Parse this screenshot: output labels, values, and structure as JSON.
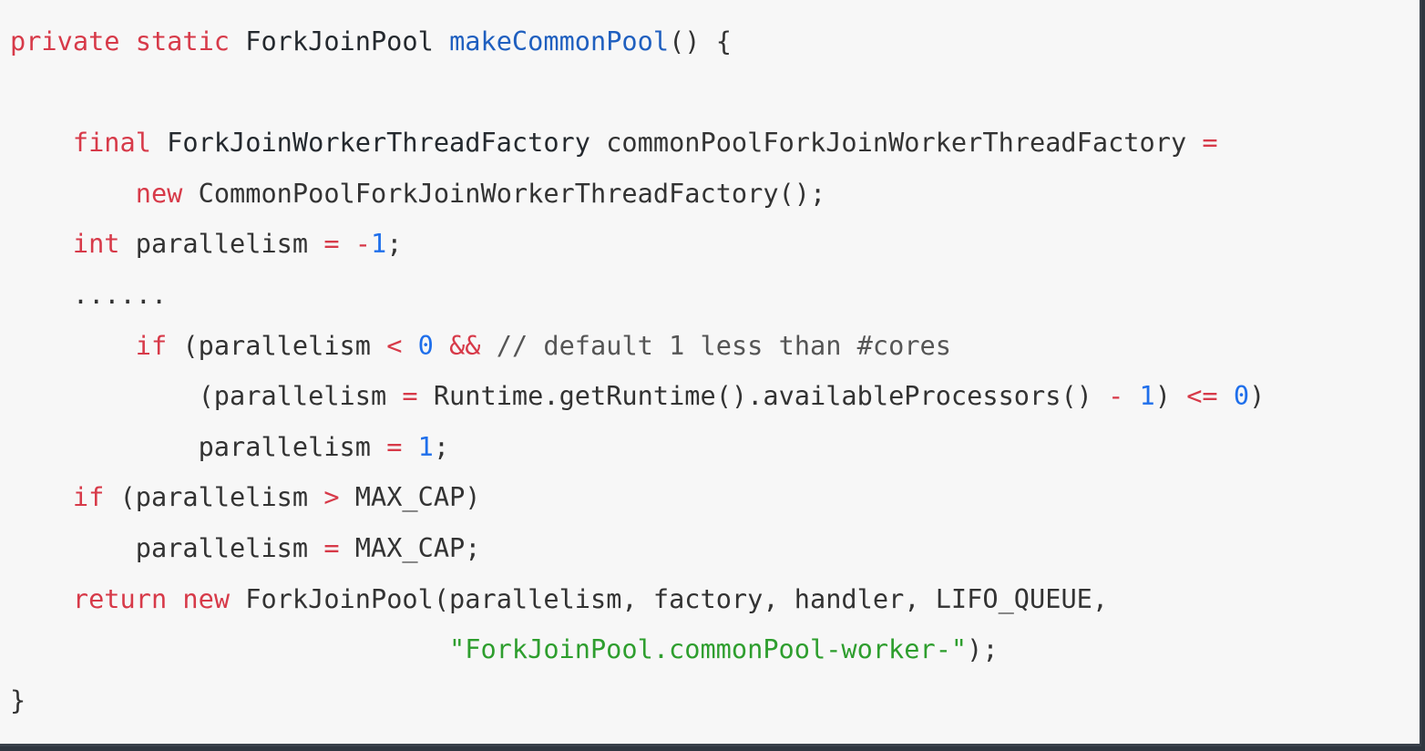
{
  "code": {
    "line1": {
      "kw_private": "private",
      "kw_static": "static",
      "type_fjp": "ForkJoinPool",
      "fn_name": "makeCommonPool",
      "tail": "() {"
    },
    "line3": {
      "kw_final": "final",
      "type_factory": "ForkJoinWorkerThreadFactory",
      "var_name": "commonPoolForkJoinWorkerThreadFactory",
      "op_eq": "="
    },
    "line4": {
      "kw_new": "new",
      "ctor": "CommonPoolForkJoinWorkerThreadFactory();"
    },
    "line5": {
      "kw_int": "int",
      "var": "parallelism",
      "op_eq": "=",
      "op_minus": "-",
      "num": "1",
      "semi": ";"
    },
    "line6": {
      "ellipsis": "......"
    },
    "line7": {
      "kw_if": "if",
      "open": "(parallelism",
      "op_lt": "<",
      "num_zero": "0",
      "op_and": "&&",
      "comment": "// default 1 less than #cores"
    },
    "line8": {
      "open": "(parallelism",
      "op_eq": "=",
      "call": "Runtime.getRuntime().availableProcessors()",
      "op_minus": "-",
      "num_one": "1",
      "close": ")",
      "op_le": "<=",
      "num_zero": "0",
      "tail": ")"
    },
    "line9": {
      "var": "parallelism",
      "op_eq": "=",
      "num": "1",
      "semi": ";"
    },
    "line10": {
      "kw_if": "if",
      "open": "(parallelism",
      "op_gt": ">",
      "rest": "MAX_CAP)"
    },
    "line11": {
      "var": "parallelism",
      "op_eq": "=",
      "rest": "MAX_CAP;"
    },
    "line12": {
      "kw_return": "return",
      "kw_new": "new",
      "rest": "ForkJoinPool(parallelism, factory, handler, LIFO_QUEUE,"
    },
    "line13": {
      "str": "\"ForkJoinPool.commonPool-worker-\"",
      "tail": ");"
    },
    "line14": {
      "close_brace": "}"
    }
  }
}
